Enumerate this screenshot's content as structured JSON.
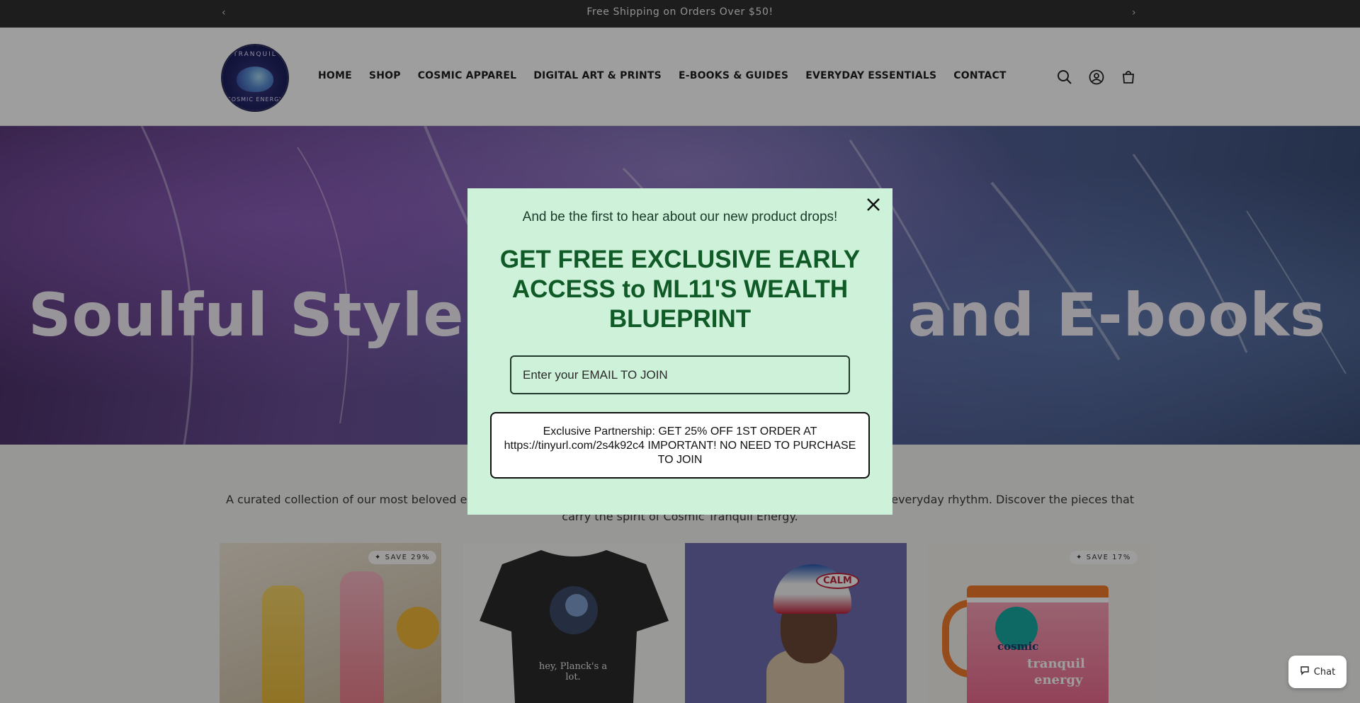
{
  "announcement": {
    "text": "Free Shipping on Orders Over $50!",
    "prev_icon": "chevron-left-icon",
    "next_icon": "chevron-right-icon"
  },
  "header": {
    "logo": {
      "top_text": "TRANQUIL",
      "bottom_text": "COSMIC ENERGY"
    },
    "nav": [
      {
        "label": "HOME"
      },
      {
        "label": "SHOP"
      },
      {
        "label": "COSMIC APPAREL"
      },
      {
        "label": "DIGITAL ART & PRINTS"
      },
      {
        "label": "E-BOOKS & GUIDES"
      },
      {
        "label": "EVERYDAY ESSENTIALS"
      },
      {
        "label": "CONTACT"
      }
    ],
    "icons": [
      "search-icon",
      "account-icon",
      "cart-icon"
    ]
  },
  "hero": {
    "title": "Soulful Style, Digital Art, and E-books"
  },
  "collection": {
    "description": "A curated collection of our most beloved essentials — each chosen to bring balance, comfort and intention into your everyday rhythm. Discover the pieces that carry the spirit of Cosmic Tranquil Energy.",
    "products": [
      {
        "badge": "SAVE 29%",
        "image": "glass-bottles"
      },
      {
        "badge": "",
        "image": "black-tshirt",
        "shirt_text": "hey, Planck's a lot."
      },
      {
        "badge": "",
        "image": "calm-cap",
        "cap_text": "CALM"
      },
      {
        "badge": "SAVE 17%",
        "image": "mug",
        "mug_text_1": "cosmic",
        "mug_text_2": "tranquil",
        "mug_text_3": "energy"
      }
    ]
  },
  "popup": {
    "subtitle": "And be the first to hear about our new product drops!",
    "headline": "GET FREE EXCLUSIVE EARLY ACCESS to ML11'S WEALTH BLUEPRINT",
    "email_placeholder": "Enter your EMAIL TO JOIN",
    "button_text": "Exclusive Partnership: GET 25% OFF 1ST ORDER AT https://tinyurl.com/2s4k92c4 IMPORTANT! NO NEED TO PURCHASE TO JOIN",
    "close_icon": "close-icon"
  },
  "chat": {
    "label": "Chat"
  },
  "colors": {
    "popup_bg": "#cdf2d9",
    "popup_heading": "#0f5a26",
    "announcement_bg": "#2f2f31"
  }
}
